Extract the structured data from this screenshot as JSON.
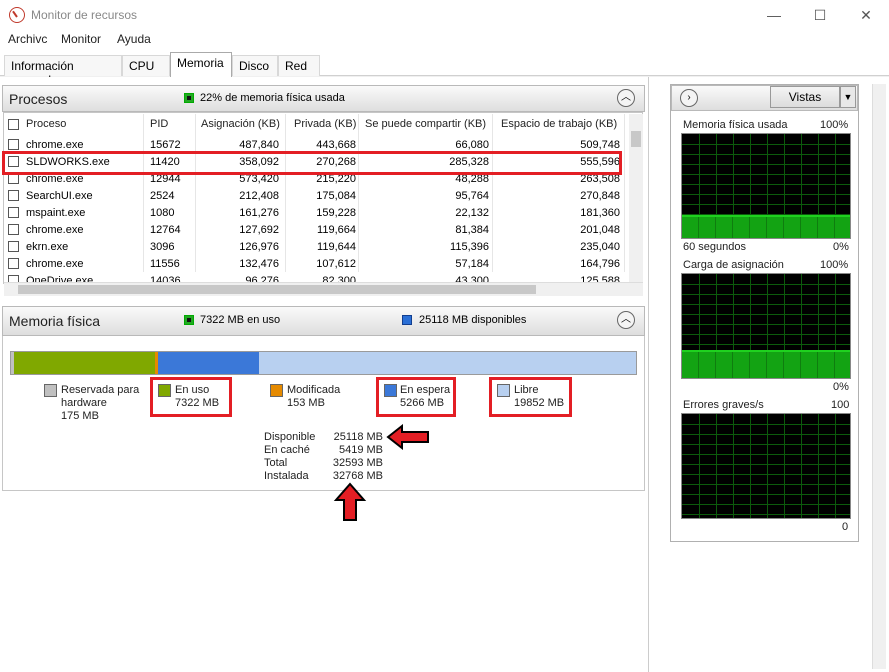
{
  "window": {
    "title": "Monitor de recursos",
    "minimize": "—",
    "maximize": "☐",
    "close": "✕"
  },
  "menu": [
    "Archivc",
    "Monitor",
    "Ayuda"
  ],
  "tabs": [
    "Información general",
    "CPU",
    "Memoria",
    "Disco",
    "Red"
  ],
  "active_tab": "Memoria",
  "processes": {
    "title": "Procesos",
    "summary": "22% de memoria física usada",
    "columns": [
      "Proceso",
      "PID",
      "Asignación (KB)",
      "Privada (KB)",
      "Se puede compartir (KB)",
      "Espacio de trabajo (KB)"
    ],
    "rows": [
      {
        "name": "chrome.exe",
        "pid": "15672",
        "commit": "487,840",
        "private": "443,668",
        "shareable": "66,080",
        "working": "509,748"
      },
      {
        "name": "SLDWORKS.exe",
        "pid": "11420",
        "commit": "358,092",
        "private": "270,268",
        "shareable": "285,328",
        "working": "555,596"
      },
      {
        "name": "chrome.exe",
        "pid": "12944",
        "commit": "573,420",
        "private": "215,220",
        "shareable": "48,288",
        "working": "263,508"
      },
      {
        "name": "SearchUI.exe",
        "pid": "2524",
        "commit": "212,408",
        "private": "175,084",
        "shareable": "95,764",
        "working": "270,848"
      },
      {
        "name": "mspaint.exe",
        "pid": "1080",
        "commit": "161,276",
        "private": "159,228",
        "shareable": "22,132",
        "working": "181,360"
      },
      {
        "name": "chrome.exe",
        "pid": "12764",
        "commit": "127,692",
        "private": "119,664",
        "shareable": "81,384",
        "working": "201,048"
      },
      {
        "name": "ekrn.exe",
        "pid": "3096",
        "commit": "126,976",
        "private": "119,644",
        "shareable": "115,396",
        "working": "235,040"
      },
      {
        "name": "chrome.exe",
        "pid": "11556",
        "commit": "132,476",
        "private": "107,612",
        "shareable": "57,184",
        "working": "164,796"
      },
      {
        "name": "OneDrive.exe",
        "pid": "14036",
        "commit": "96,276",
        "private": "82,300",
        "shareable": "43,300",
        "working": "125,588"
      }
    ]
  },
  "physical_memory": {
    "title": "Memoria física",
    "in_use_summary": "7322 MB en uso",
    "available_summary": "25118 MB disponibles",
    "bar_fractions": {
      "reserved": 0.005,
      "in_use": 0.225,
      "modified": 0.005,
      "standby": 0.162,
      "free": 0.603
    },
    "legend": [
      {
        "label": "Reservada para",
        "label2": "hardware",
        "value": "175 MB",
        "color": "#c0c0c0"
      },
      {
        "label": "En uso",
        "label2": "",
        "value": "7322 MB",
        "color": "#80a800"
      },
      {
        "label": "Modificada",
        "label2": "",
        "value": "153 MB",
        "color": "#e58a00"
      },
      {
        "label": "En espera",
        "label2": "",
        "value": "5266 MB",
        "color": "#3b78d8"
      },
      {
        "label": "Libre",
        "label2": "",
        "value": "19852 MB",
        "color": "#b8d0f0"
      }
    ],
    "stats": [
      {
        "label": "Disponible",
        "value": "25118 MB"
      },
      {
        "label": "En caché",
        "value": "5419 MB"
      },
      {
        "label": "Total",
        "value": "32593 MB"
      },
      {
        "label": "Instalada",
        "value": "32768 MB"
      }
    ]
  },
  "right_panel": {
    "views_button": "Vistas",
    "graphs": [
      {
        "title": "Memoria física usada",
        "max": "100%",
        "footer_left": "60 segundos",
        "footer_right": "0%",
        "level": 0.22
      },
      {
        "title": "Carga de asignación",
        "max": "100%",
        "footer_left": "",
        "footer_right": "0%",
        "level": 0.27
      },
      {
        "title": "Errores graves/s",
        "max": "100",
        "footer_left": "",
        "footer_right": "0",
        "level": 0.0
      }
    ]
  },
  "colors": {
    "highlight_red": "#e31e24",
    "graph_green": "#1fd11f",
    "graph_bg": "#000000"
  }
}
